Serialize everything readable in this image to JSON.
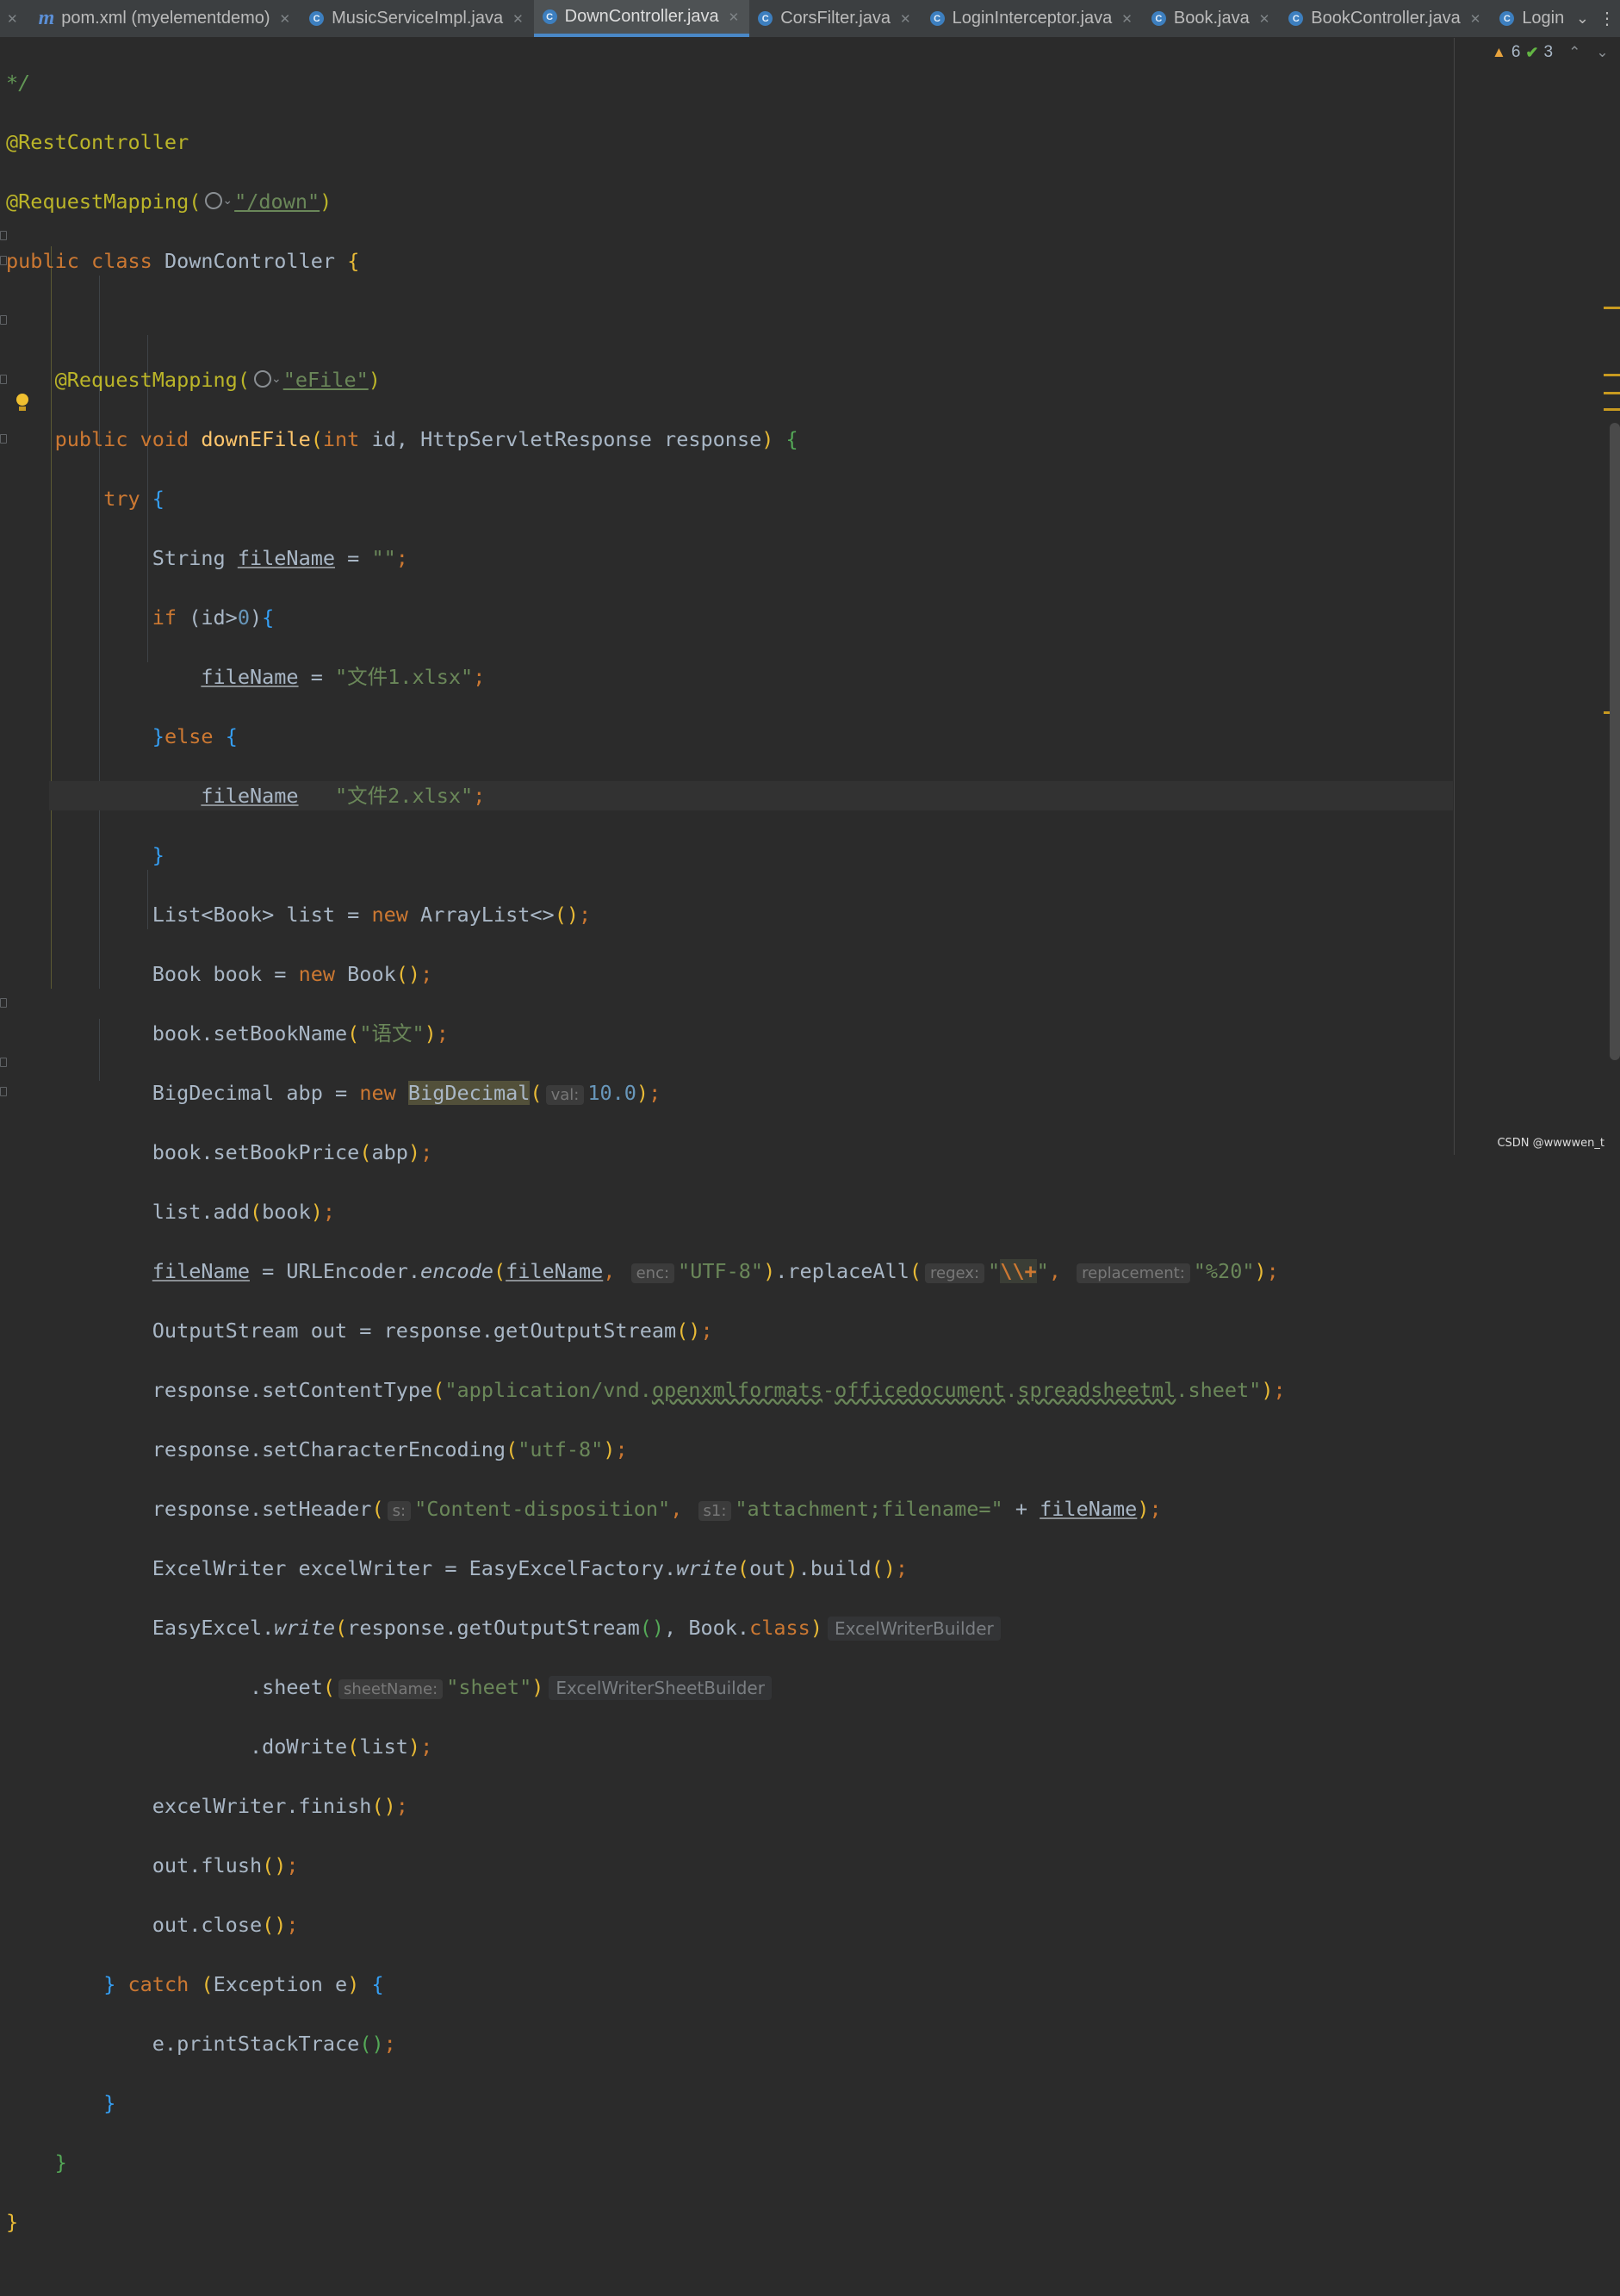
{
  "tabs": {
    "items": [
      {
        "label": "pom.xml (myelementdemo)",
        "icon": "m"
      },
      {
        "label": "MusicServiceImpl.java",
        "icon": "C"
      },
      {
        "label": "DownController.java",
        "icon": "C",
        "active": true
      },
      {
        "label": "CorsFilter.java",
        "icon": "C"
      },
      {
        "label": "LoginInterceptor.java",
        "icon": "C"
      },
      {
        "label": "Book.java",
        "icon": "C"
      },
      {
        "label": "BookController.java",
        "icon": "C"
      },
      {
        "label": "Login",
        "icon": "C"
      }
    ],
    "more_icon": "chevron-down-icon",
    "menu_icon": "more-vertical-icon"
  },
  "inspections": {
    "warnings": "6",
    "ok": "3"
  },
  "code": {
    "comment_end": "*/",
    "rest_controller": "@RestController",
    "request_mapping": "@RequestMapping(",
    "class_path": "\"/down\"",
    "class_public": "public",
    "class_kw": "class",
    "class_name": "DownController",
    "method_annotation": "@RequestMapping(",
    "method_path": "\"eFile\"",
    "method_public": "public",
    "method_void": "void",
    "method_name": "downEFile",
    "param_int": "int",
    "param_rest": " id, HttpServletResponse response",
    "try_kw": "try",
    "str_decl": "String ",
    "var_filename": "fileName",
    "empty_str": "\"\"",
    "if_kw": "if",
    "if_cond": "(id>",
    "zero": "0",
    "file1": "\"文件1.xlsx\"",
    "else_kw": "else",
    "file2": "\"文件2.xlsx\"",
    "list_decl": "List<Book> list = ",
    "new_kw": "new",
    "arraylist": " ArrayList<>",
    "book_decl": "Book book = ",
    "book_ctor": " Book",
    "set_book_name": "book.setBookName",
    "book_name_val": "\"语文\"",
    "bigdecimal_decl": "BigDecimal abp = ",
    "bigdecimal_ctor": "BigDecimal",
    "hint_val": "val:",
    "num_val": "10.0",
    "set_book_price": "book.setBookPrice",
    "abp": "abp",
    "list_add": "list.add",
    "book_var": "book",
    "url_encoder": " = URLEncoder.",
    "encode_fn": "encode",
    "hint_enc": "enc:",
    "utf8": "\"UTF-8\"",
    "replace_all": ".replaceAll",
    "hint_regex": "regex:",
    "regex_open": "\"",
    "regex_esc": "\\\\+",
    "regex_close": "\"",
    "hint_replacement": "replacement:",
    "pct20": "\"%20\"",
    "output_stream": "OutputStream out = response.getOutputStream",
    "set_content_type": "response.setContentType",
    "ct_1": "\"application/vnd.",
    "ct_2": "openxmlformats",
    "ct_3": "-",
    "ct_4": "officedocument",
    "ct_5": ".",
    "ct_6": "spreadsheetml",
    "ct_7": ".sheet\"",
    "set_char_enc": "response.setCharacterEncoding",
    "utf8_lower": "\"utf-8\"",
    "set_header": "response.setHeader",
    "hint_s": "s:",
    "content_disp": "\"Content-disposition\"",
    "hint_s1": "s1:",
    "attachment": "\"attachment;filename=\"",
    "plus": " + ",
    "excel_writer_decl": "ExcelWriter excelWriter = EasyExcelFactory.",
    "write_fn": "write",
    "out_var": "out",
    "build": ".build",
    "easyexcel": "EasyExcel.",
    "get_output": "response.getOutputStream",
    "book_class": ", Book.",
    "class_kw2": "class",
    "type_hint_1": "ExcelWriterBuilder",
    "sheet_call": "        .sheet",
    "hint_sheet_name": "sheetName:",
    "sheet_str": "\"sheet\"",
    "type_hint_2": "ExcelWriterSheetBuilder",
    "do_write": "        .doWrite",
    "list_var": "list",
    "finish": "excelWriter.finish",
    "flush": "out.flush",
    "close": "out.close",
    "catch_kw": "catch",
    "exception": "Exception e",
    "print_stack": "e.printStackTrace"
  },
  "watermark": "CSDN @wwwwen_t"
}
